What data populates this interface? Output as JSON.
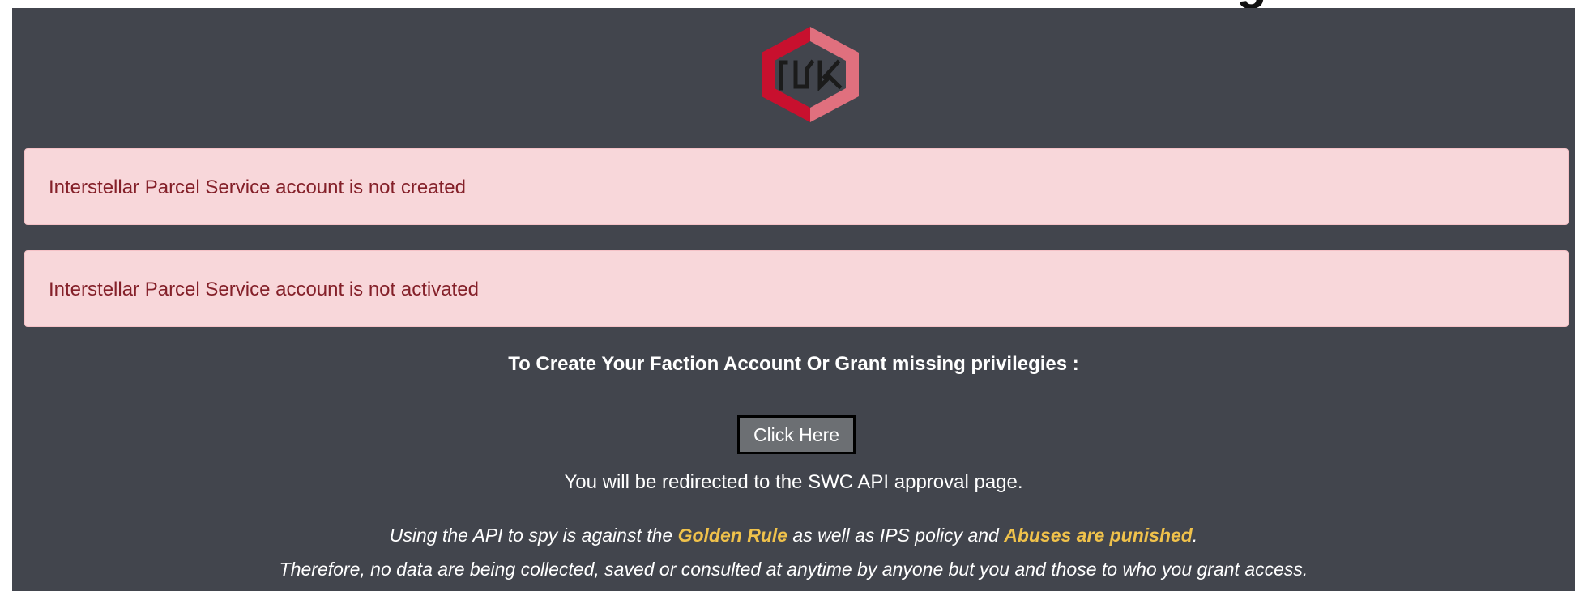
{
  "header": {
    "cut_title": "Interstellar Parcel Service - Faction Login"
  },
  "logo": {
    "lettering": "IDV",
    "colors": {
      "left": "#c8102e",
      "right": "#e0707e"
    }
  },
  "alerts": [
    {
      "text": "Interstellar Parcel Service account is not created"
    },
    {
      "text": "Interstellar Parcel Service account is not activated"
    }
  ],
  "cta": {
    "heading": "To Create Your Faction Account Or Grant missing privilegies :",
    "button_label": "Click Here",
    "redirect_note": "You will be redirected to the SWC API approval page."
  },
  "policy": {
    "line1_a": "Using the API to spy is against the ",
    "line1_golden": "Golden Rule",
    "line1_b": " as well as IPS policy and ",
    "line1_abuses": "Abuses are punished",
    "line1_c": ".",
    "line2": "Therefore, no data are being collected, saved or consulted at anytime by anyone but you and those to who you grant access."
  },
  "colors": {
    "panel_bg": "#42454d",
    "alert_bg": "#f8d7da",
    "alert_text": "#842029",
    "highlight": "#f0c24b"
  }
}
